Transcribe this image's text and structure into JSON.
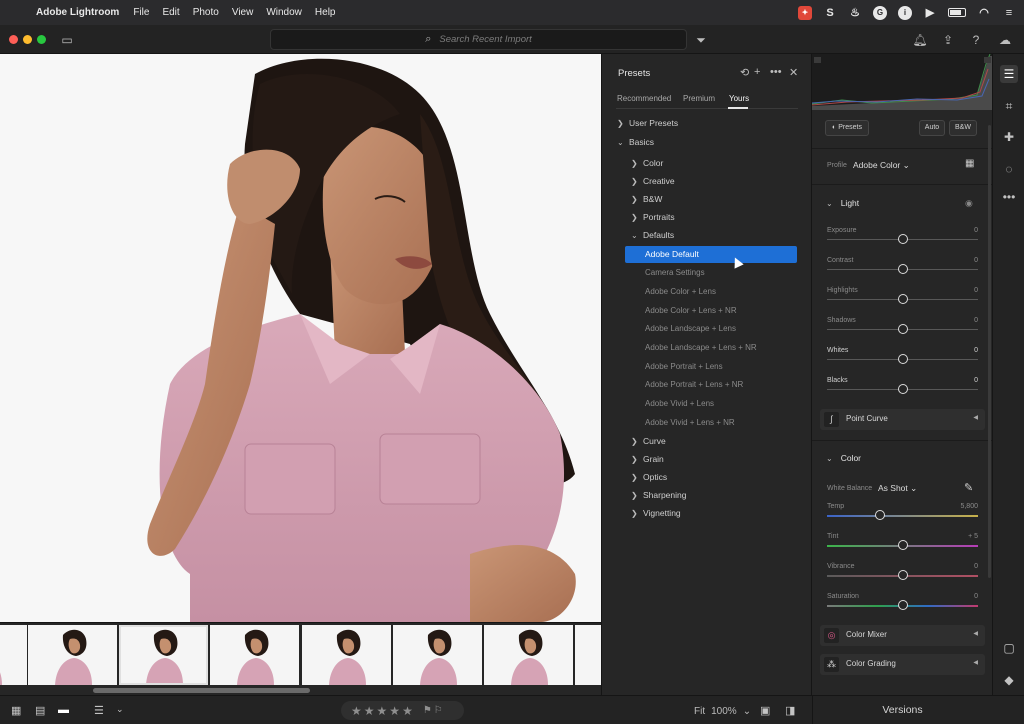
{
  "menubar": {
    "app_name": "Adobe Lightroom",
    "menus": [
      "File",
      "Edit",
      "Photo",
      "View",
      "Window",
      "Help"
    ]
  },
  "topbar": {
    "search_placeholder": "Search Recent Import"
  },
  "presets": {
    "title": "Presets",
    "tabs": [
      "Recommended",
      "Premium",
      "Yours"
    ],
    "active_tab": "Yours",
    "tree": {
      "user_presets": "User Presets",
      "basics": "Basics",
      "groups": [
        "Color",
        "Creative",
        "B&W",
        "Portraits",
        "Defaults"
      ],
      "defaults_items": [
        "Adobe Default",
        "Camera Settings",
        "Adobe Color + Lens",
        "Adobe Color + Lens + NR",
        "Adobe Landscape + Lens",
        "Adobe Landscape + Lens + NR",
        "Adobe Portrait + Lens",
        "Adobe Portrait + Lens + NR",
        "Adobe Vivid + Lens",
        "Adobe Vivid + Lens + NR"
      ],
      "selected": "Adobe Default",
      "more_groups": [
        "Curve",
        "Grain",
        "Optics",
        "Sharpening",
        "Vignetting"
      ]
    }
  },
  "edit": {
    "presets_button": "Presets",
    "auto_button": "Auto",
    "bw_button": "B&W",
    "profile_label": "Profile",
    "profile_value": "Adobe Color",
    "light": {
      "title": "Light",
      "sliders": [
        {
          "label": "Exposure",
          "value": "0",
          "position": 0.5
        },
        {
          "label": "Contrast",
          "value": "0",
          "position": 0.5
        },
        {
          "label": "Highlights",
          "value": "0",
          "position": 0.5
        },
        {
          "label": "Shadows",
          "value": "0",
          "position": 0.5
        },
        {
          "label": "Whites",
          "value": "0",
          "position": 0.5
        },
        {
          "label": "Blacks",
          "value": "0",
          "position": 0.5
        }
      ]
    },
    "point_curve": "Point Curve",
    "color": {
      "title": "Color",
      "wb_label": "White Balance",
      "wb_value": "As Shot",
      "sliders": [
        {
          "label": "Temp",
          "value": "5,800",
          "position": 0.35
        },
        {
          "label": "Tint",
          "value": "+ 5",
          "position": 0.5
        },
        {
          "label": "Vibrance",
          "value": "0",
          "position": 0.5
        },
        {
          "label": "Saturation",
          "value": "0",
          "position": 0.5
        }
      ]
    },
    "color_mixer": "Color Mixer",
    "color_grading": "Color Grading"
  },
  "bottombar": {
    "zoom_fit": "Fit",
    "zoom_pct": "100%",
    "versions": "Versions",
    "stars": [
      "★",
      "★",
      "★",
      "★",
      "★"
    ]
  },
  "filmstrip": {
    "selected_index": 1
  },
  "colors": {
    "accent": "#1e6fd6",
    "panel_bg": "#262626"
  }
}
